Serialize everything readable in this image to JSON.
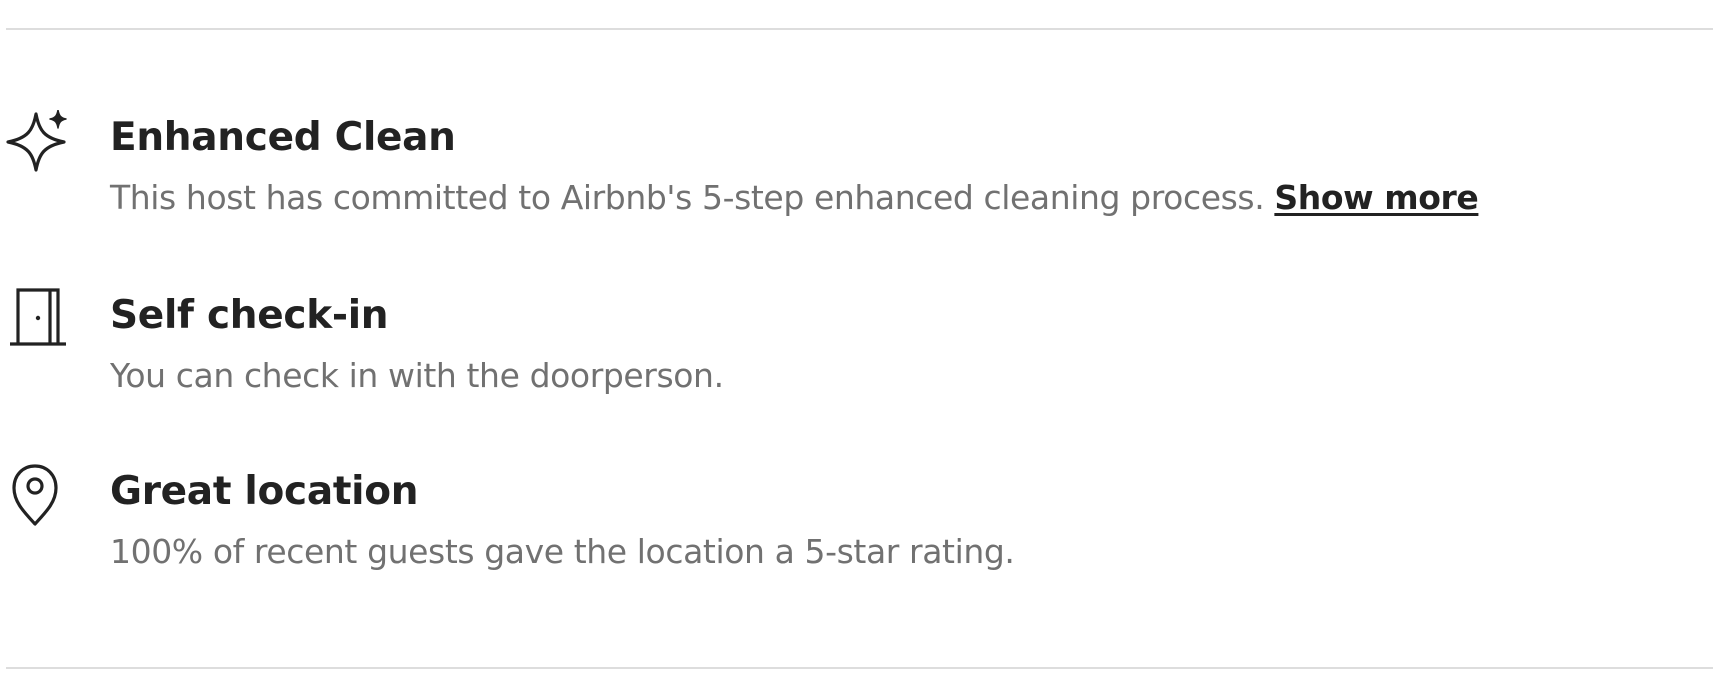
{
  "highlights": [
    {
      "icon": "sparkle-icon",
      "title": "Enhanced Clean",
      "description": "This host has committed to Airbnb's 5-step enhanced cleaning process.",
      "link_label": "Show more"
    },
    {
      "icon": "door-icon",
      "title": "Self check-in",
      "description": "You can check in with the doorperson."
    },
    {
      "icon": "location-pin-icon",
      "title": "Great location",
      "description": "100% of recent guests gave the location a 5-star rating."
    }
  ],
  "colors": {
    "title": "#222222",
    "description": "#717171",
    "divider": "#dddddd"
  }
}
